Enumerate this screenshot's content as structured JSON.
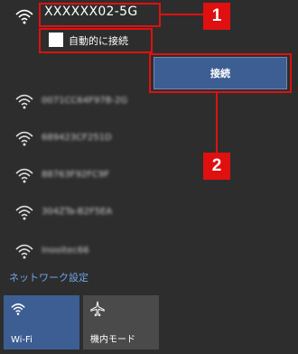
{
  "selected_network": {
    "ssid": "XXXXXX02-5G",
    "auto_connect_label": "自動的に接続",
    "connect_button": "接続"
  },
  "other_networks": [
    {
      "name": "0071CC64F97B-2G"
    },
    {
      "name": "689423CF251D"
    },
    {
      "name": "88763F92FC9F"
    },
    {
      "name": "304ZTa-B2F5EA"
    },
    {
      "name": "Inooitec66"
    }
  ],
  "network_settings_link": "ネットワーク設定",
  "quick_actions": [
    {
      "label": "Wi-Fi",
      "icon": "wifi-icon",
      "active": true
    },
    {
      "label": "機内モード",
      "icon": "airplane-icon",
      "active": false
    }
  ],
  "callouts": [
    "1",
    "2"
  ],
  "colors": {
    "background": "#2d2d2d",
    "accent": "#3d5e93",
    "callout": "#e01010",
    "link": "#6fa4e8"
  }
}
